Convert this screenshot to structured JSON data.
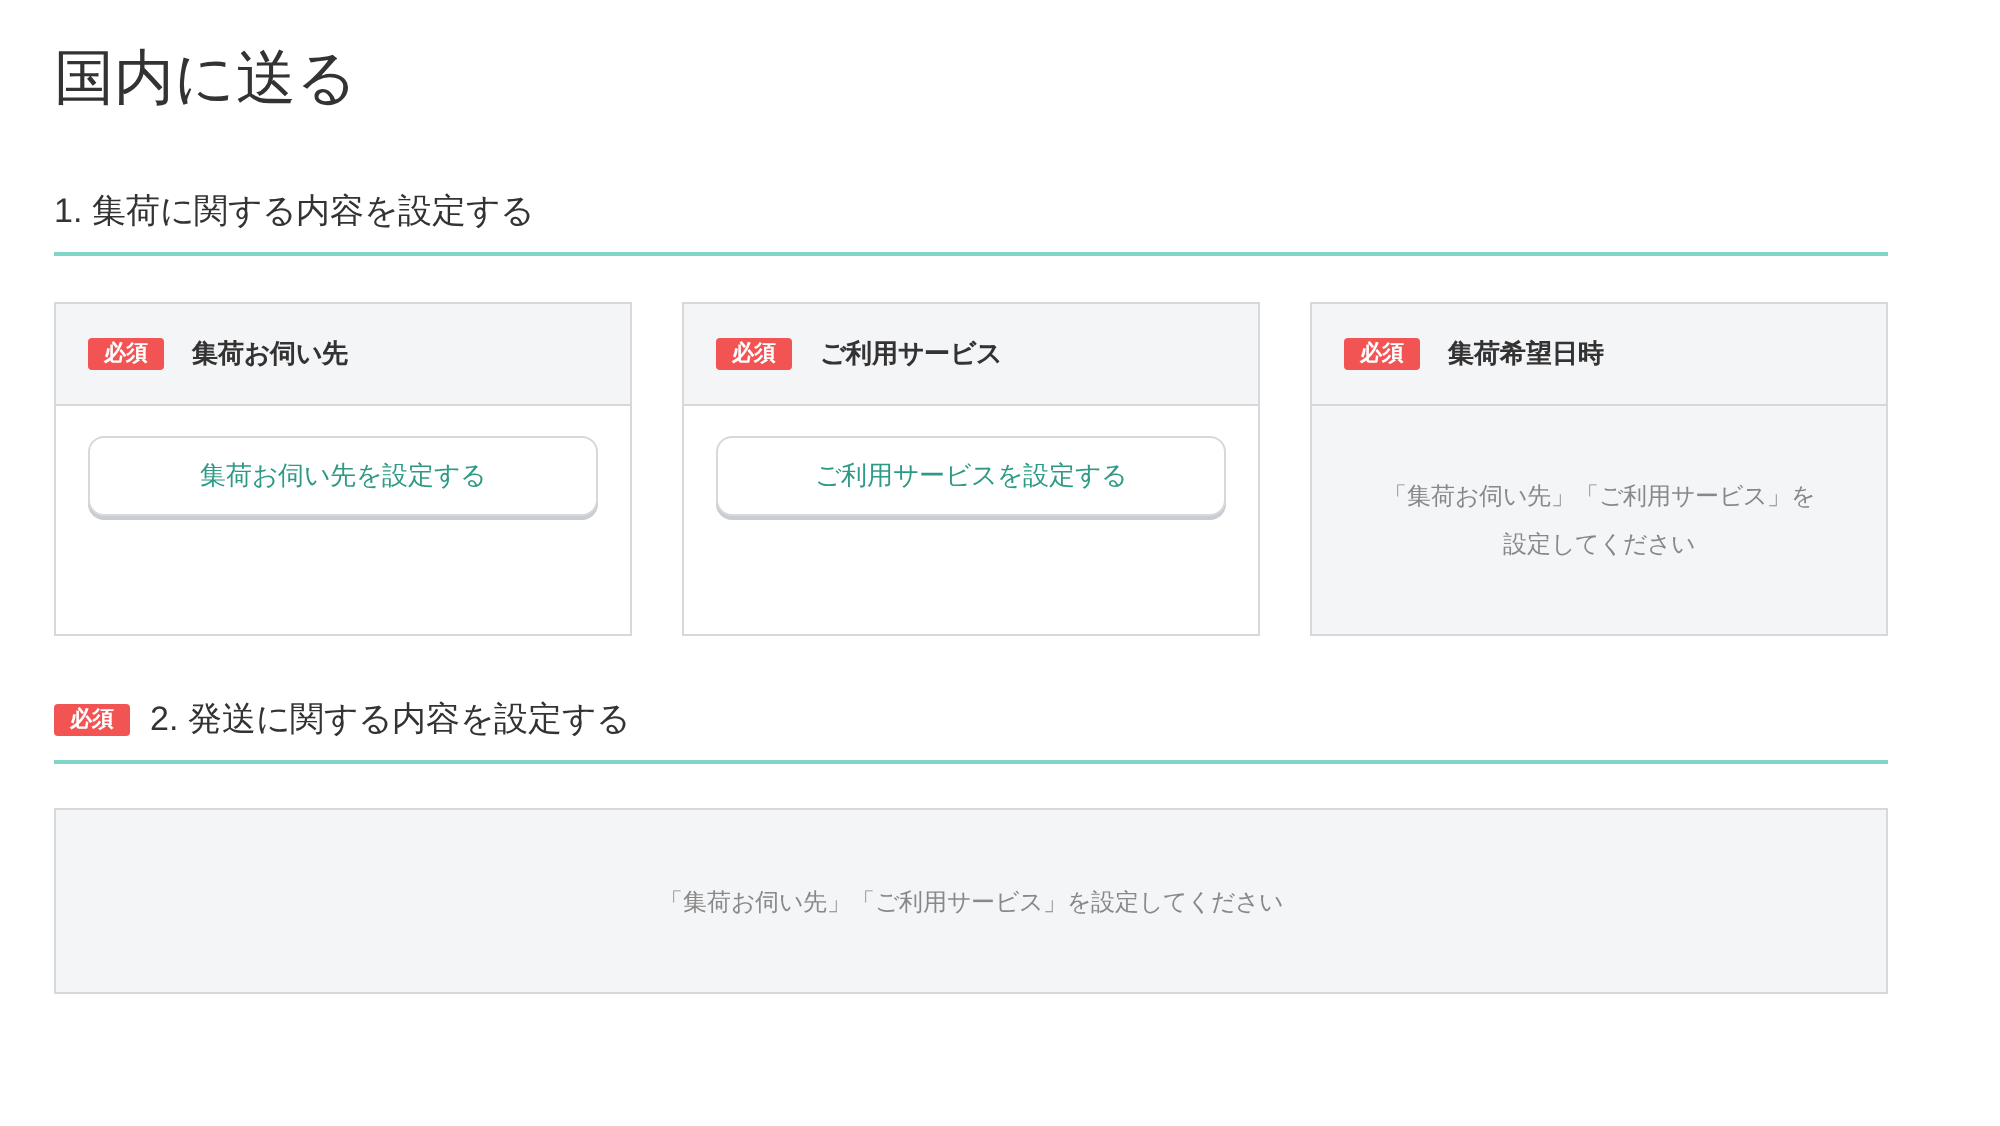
{
  "page_title": "国内に送る",
  "sections": [
    {
      "heading": "1. 集荷に関する内容を設定する",
      "required": false,
      "cards": [
        {
          "badge": "必須",
          "title": "集荷お伺い先",
          "kind": "button",
          "text": "集荷お伺い先を設定する"
        },
        {
          "badge": "必須",
          "title": "ご利用サービス",
          "kind": "button",
          "text": "ご利用サービスを設定する"
        },
        {
          "badge": "必須",
          "title": "集荷希望日時",
          "kind": "note",
          "lines": [
            "「集荷お伺い先」「ご利用サービス」を",
            "設定してください"
          ]
        }
      ]
    },
    {
      "heading": "2. 発送に関する内容を設定する",
      "required": true,
      "badge": "必須",
      "note": "「集荷お伺い先」「ご利用サービス」を設定してください"
    }
  ]
}
